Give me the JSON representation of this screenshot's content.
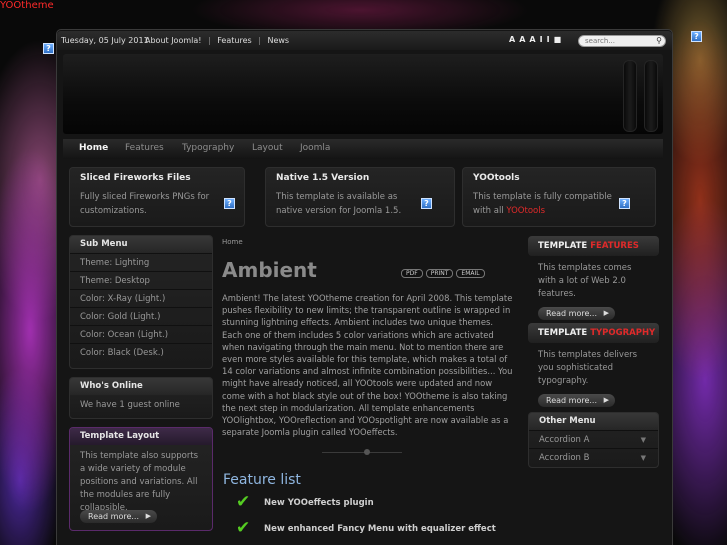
{
  "site": {
    "name": "YOOtheme"
  },
  "topbar": {
    "date": "Tuesday, 05 July 2011",
    "nav": [
      "About Joomla!",
      "Features",
      "News"
    ],
    "separator": "|",
    "tools": [
      "A",
      "A",
      "A",
      "I",
      "I",
      "■"
    ],
    "search_placeholder": "search..."
  },
  "menu": {
    "items": [
      "Home",
      "Features",
      "Typography",
      "Layout",
      "Joomla"
    ],
    "active": "Home"
  },
  "top_modules": [
    {
      "title": "Sliced Fireworks Files",
      "text": "Fully sliced Fireworks PNGs for customizations."
    },
    {
      "title": "Native 1.5 Version",
      "text": "This template is available as native version for Joomla 1.5."
    },
    {
      "title": "YOOtools",
      "text": "This template is fully compatible with all ",
      "link": "YOOtools"
    }
  ],
  "sub_menu": {
    "title": "Sub Menu",
    "items": [
      "Theme: Lighting",
      "Theme: Desktop",
      "Color: X-Ray (Light.)",
      "Color: Gold (Light.)",
      "Color: Ocean (Light.)",
      "Color: Black (Desk.)"
    ]
  },
  "whos_online": {
    "title": "Who's Online",
    "text": "We have 1 guest online"
  },
  "template_layout": {
    "title": "Template Layout",
    "text": "This template also supports a wide variety of module positions and variations. All the modules are fully collapsible.",
    "button": "Read more..."
  },
  "main": {
    "breadcrumb": "Home",
    "title": "Ambient",
    "icons": [
      "PDF",
      "PRINT",
      "EMAIL"
    ],
    "body": "Ambient! The latest YOOtheme creation for April 2008. This template pushes flexibility to new limits; the transparent outline is wrapped in stunning lightning effects. Ambient includes two unique themes. Each one of them includes 5 color variations which are activated when navigating through the main menu. Not to mention there are even more styles available for this template, which makes a total of 14 color variations and almost infinite combination possibilities... You might have already noticed, all YOOtools were updated and now come with a hot black style out of the box! YOOtheme is also taking the next step in modularization. All template enhancements YOOlightbox, YOOreflection and YOOspotlight are now available as a separate Joomla plugin called YOOeffects.",
    "feature_title": "Feature list",
    "features": [
      "New YOOeffects plugin",
      "New enhanced Fancy Menu with equalizer effect"
    ]
  },
  "right": {
    "features_box": {
      "title_a": "TEMPLATE ",
      "title_b": "FEATURES",
      "text": "This templates comes with a lot of Web 2.0 features.",
      "button": "Read more..."
    },
    "typography_box": {
      "title_a": "TEMPLATE ",
      "title_b": "TYPOGRAPHY",
      "text": "This templates delivers you sophisticated typography.",
      "button": "Read more..."
    },
    "other_menu": {
      "title": "Other Menu",
      "items": [
        "Accordion A",
        "Accordion B"
      ]
    }
  },
  "colors": {
    "accent_red": "#e02a2a",
    "feature_blue": "#8fb6e0",
    "check_green": "#55cc22"
  }
}
